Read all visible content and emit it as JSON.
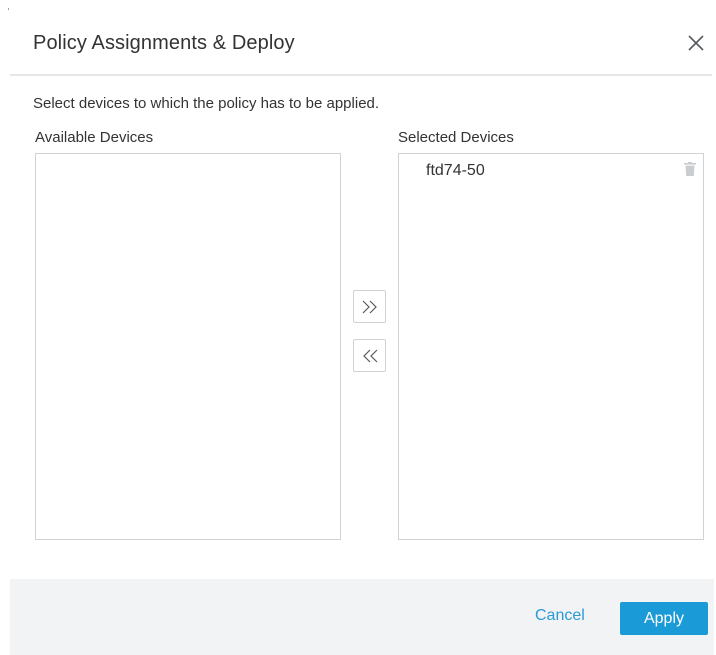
{
  "dialog": {
    "title": "Policy Assignments & Deploy",
    "instruction": "Select devices to which the policy has to be applied."
  },
  "available": {
    "label": "Available Devices",
    "items": []
  },
  "selected": {
    "label": "Selected Devices",
    "items": [
      {
        "label": "ftd74-50"
      }
    ]
  },
  "icons": {
    "close": "close-icon",
    "move_right": "double-chevron-right-icon",
    "move_left": "double-chevron-left-icon",
    "delete": "trash-icon"
  },
  "footer": {
    "cancel_label": "Cancel",
    "apply_label": "Apply"
  },
  "colors": {
    "accent": "#1a9ad6",
    "link": "#2b9ad6",
    "footer_bg": "#f2f3f4",
    "border": "#cfd3d6"
  }
}
